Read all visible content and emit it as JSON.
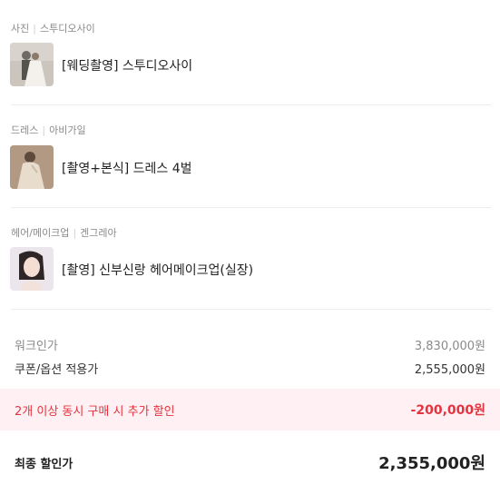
{
  "items": [
    {
      "category": "사진",
      "vendor": "스투디오사이",
      "title": "[웨딩촬영] 스투디오사이",
      "thumb_colors": [
        "#c9c3bb",
        "#7d7a72",
        "#f2efe9"
      ]
    },
    {
      "category": "드레스",
      "vendor": "아비가일",
      "title": "[촬영+본식] 드레스 4벌",
      "thumb_colors": [
        "#b59e86",
        "#6e5846",
        "#e6d9c9"
      ]
    },
    {
      "category": "헤어/메이크업",
      "vendor": "겐그레아",
      "title": "[촬영] 신부신랑 헤어메이크업(실장)",
      "thumb_colors": [
        "#e9e4ea",
        "#2b2323",
        "#f3dcd2"
      ]
    }
  ],
  "summary": {
    "list_price_label": "워크인가",
    "list_price_value": "3,830,000원",
    "coupon_label": "쿠폰/옵션 적용가",
    "coupon_value": "2,555,000원",
    "discount_label": "2개 이상 동시 구매 시 추가 할인",
    "discount_value": "-200,000원",
    "final_label": "최종 할인가",
    "final_value": "2,355,000원"
  },
  "colors": {
    "accent_red": "#e5333f",
    "discount_bg": "#fff1f3"
  }
}
